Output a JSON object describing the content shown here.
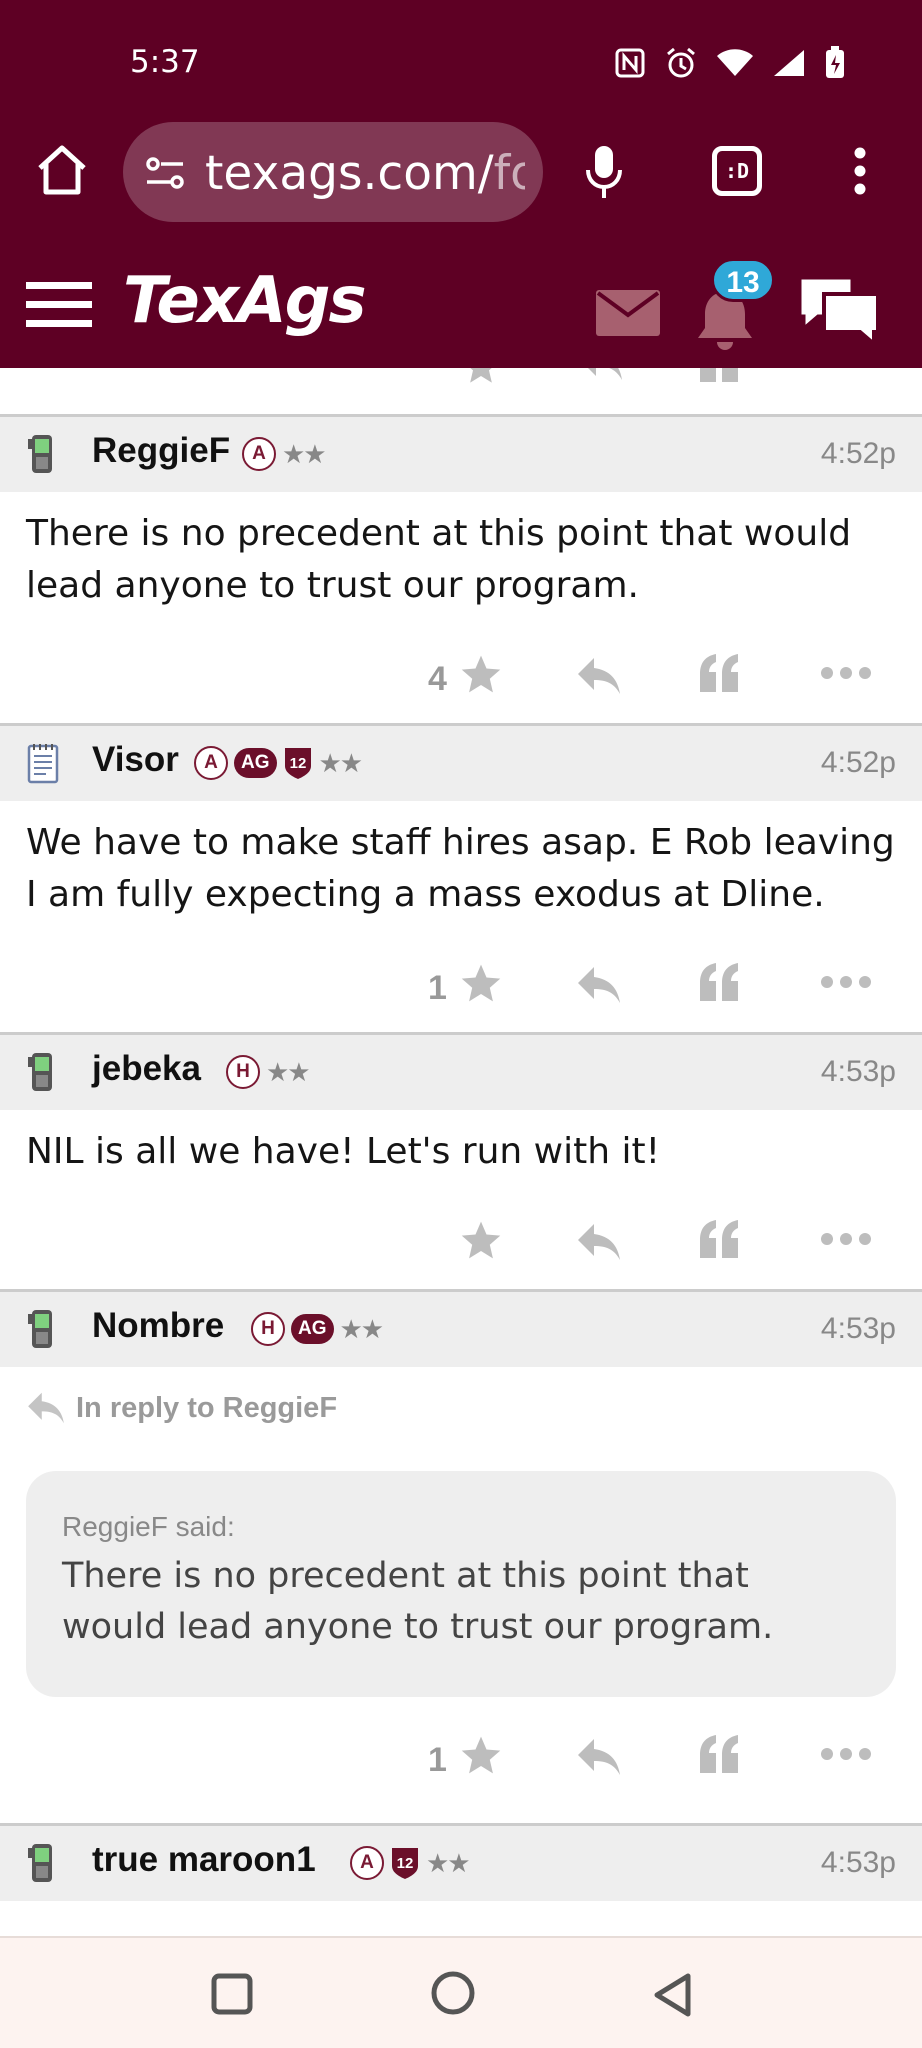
{
  "status_bar": {
    "time": "5:37"
  },
  "browser": {
    "url_main": "texags.com/",
    "url_rest": "for",
    "tabs_label": ":D"
  },
  "site_nav": {
    "logo": "TexAgs",
    "notification_count": "13"
  },
  "posts": [
    {
      "username": "ReggieF",
      "tags": [
        "A"
      ],
      "time": "4:52p",
      "body": "There is no precedent at this point that would lead anyone to trust our program.",
      "likes": "4"
    },
    {
      "username": "Visor",
      "tags": [
        "A",
        "AG",
        "12"
      ],
      "time": "4:52p",
      "body": "We have to make staff hires asap. E Rob leaving I am fully expecting a mass exodus at Dline.",
      "likes": "1"
    },
    {
      "username": "jebeka",
      "tags": [
        "H"
      ],
      "time": "4:53p",
      "body": "NIL is all we have! Let's run with it!",
      "likes": ""
    },
    {
      "username": "Nombre",
      "tags": [
        "H",
        "AG"
      ],
      "time": "4:53p",
      "reply_to": "In reply to ReggieF",
      "quote_author": "ReggieF said:",
      "quote_text": "There is no precedent at this point that would lead anyone to trust our program.",
      "likes": "1"
    },
    {
      "username": "true maroon1",
      "tags": [
        "A",
        "12"
      ],
      "time": "4:53p"
    }
  ],
  "colors": {
    "brand_maroon": "#5e0024",
    "badge_blue": "#2fa8d8",
    "post_header_bg": "#eeeeee"
  }
}
